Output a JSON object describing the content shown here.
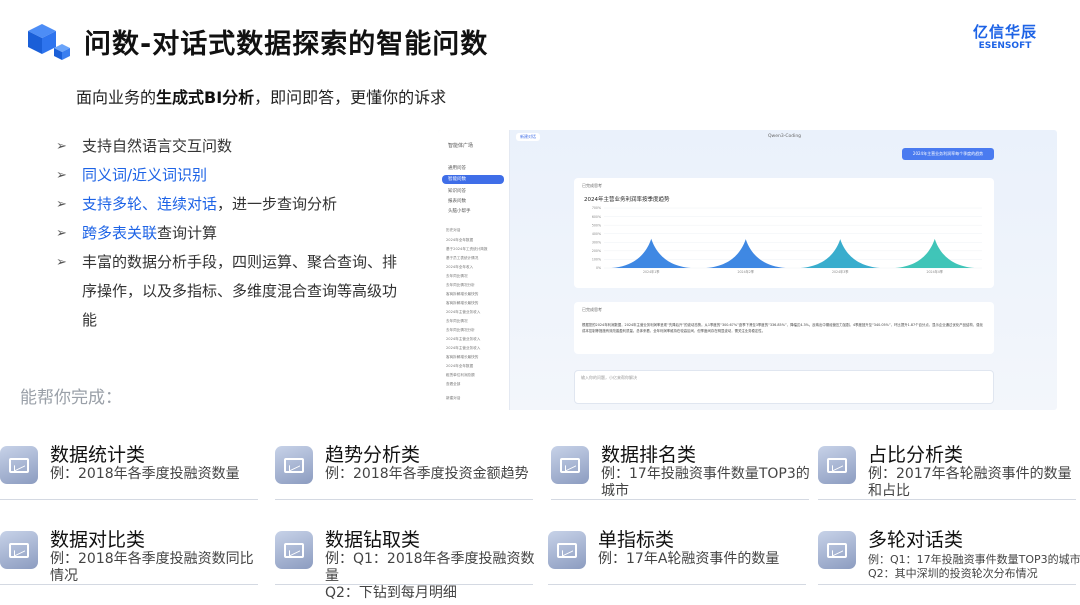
{
  "header": {
    "title": "问数-对话式数据探索的智能问数",
    "brand_cn": "亿信华辰",
    "brand_en": "ESENSOFT"
  },
  "subtitle": {
    "prefix": "面向业务的",
    "bold": "生成式BI分析",
    "suffix": "，即问即答，更懂你的诉求"
  },
  "features": [
    {
      "highlight": "",
      "text": "支持自然语言交互问数"
    },
    {
      "highlight": "同义词/近义词识别",
      "text": ""
    },
    {
      "highlight": "支持多轮、连续对话",
      "text": "，进一步查询分析"
    },
    {
      "highlight": "跨多表关联",
      "text": "查询计算"
    },
    {
      "highlight": "",
      "text": "丰富的数据分析手段，四则运算、聚合查询、排序操作，以及多指标、多维度混合查询等高级功能"
    }
  ],
  "can_do": "能帮你完成：",
  "screenshot": {
    "sidebar_title": "智能体广场",
    "sidebar_items": [
      "通用问答",
      "智能问数",
      "知识问答",
      "报表问数",
      "头脑小帮手"
    ],
    "history_label": "历史对话",
    "history_items": [
      "2024年全年数据",
      "基于2024年工资统计简报",
      "基于员工表统计情况",
      "2024年全年收入",
      "去年同比情况",
      "去年同比情况分析",
      "客商拆解增长最快的",
      "客商拆解增长最快的",
      "2024年主营业务收入",
      "去年同比情况",
      "去年同比情况分析",
      "2024年主营业务收入",
      "2024年主营业务收入",
      "客商拆解增长最快的",
      "2024年全年数据",
      "租赁单位利润总额",
      "查看全部"
    ],
    "new_chat": "新建对话",
    "chat_title": "Qwen3-Coding",
    "user_query": "2024年主营业务利润率每个季度的趋势",
    "answer_tag": "已完成思考",
    "chart_title": "2024年主营业务利润率按季度趋势",
    "answer_text": "根据您的2024年利润数据，2024年主营业务利润率呈现“先降后升”的波动态势。从1季度的“300.67%”逐季下滑至3季度的“336.85%”，降幅达4.3%。反映出中期经营压力加剧。4季度回升至“340.05%”，环比提升1.87个百分点，显示企业通过优化产品结构、强化成本控制等措施有效改善盈利质量。总体来看，全年利润率维持在较高区间，但季度间存在明显波动，需关注业务稳定性。",
    "input_placeholder": "输入你的问题，小亿来帮你解决",
    "input_hint": "内容由AI生成"
  },
  "chart_data": {
    "type": "area",
    "title": "2024年主营业务利润率按季度趋势",
    "categories": [
      "2024年1季",
      "2024年2季",
      "2024年3季",
      "2024年4季"
    ],
    "y_ticks": [
      "0%",
      "100%",
      "200%",
      "300%",
      "400%",
      "500%",
      "600%",
      "700%"
    ],
    "values": [
      340.67,
      336.85,
      336.85,
      340.05
    ],
    "ylim": [
      0,
      700
    ],
    "colors": [
      "#2a7be0",
      "#2bbfb0"
    ]
  },
  "capabilities": [
    {
      "name": "数据统计类",
      "desc": "例：2018年各季度投融资数量",
      "small": false
    },
    {
      "name": "趋势分析类",
      "desc": "例：2018年各季度投资金额趋势",
      "small": false
    },
    {
      "name": "数据排名类",
      "desc": "例：17年投融资事件数量TOP3的城市",
      "small": false
    },
    {
      "name": "占比分析类",
      "desc": "例：2017年各轮融资事件的数量和占比",
      "small": false
    },
    {
      "name": "数据对比类",
      "desc": "例：2018年各季度投融资数同比情况",
      "small": false
    },
    {
      "name": "数据钻取类",
      "desc": "例：Q1：2018年各季度投融资数量\nQ2：下钻到每月明细",
      "small": false
    },
    {
      "name": "单指标类",
      "desc": "例：17年A轮融资事件的数量",
      "small": false
    },
    {
      "name": "多轮对话类",
      "desc": "例：Q1：17年投融资事件数量TOP3的城市\nQ2：其中深圳的投资轮次分布情况",
      "small": true
    }
  ]
}
